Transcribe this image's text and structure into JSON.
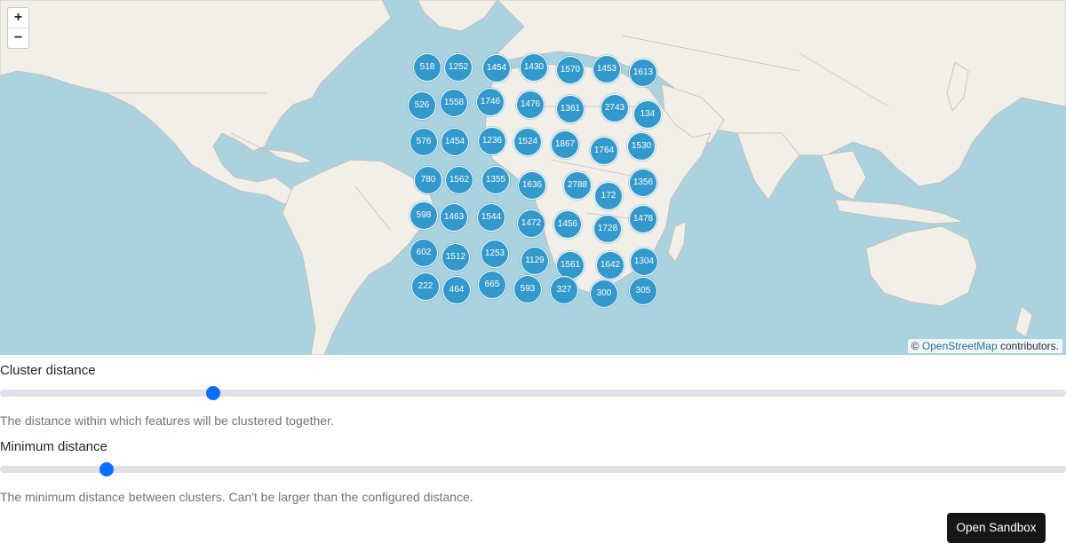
{
  "map": {
    "zoom_in_label": "+",
    "zoom_out_label": "−",
    "attribution_prefix": "© ",
    "attribution_link": "OpenStreetMap",
    "attribution_suffix": " contributors.",
    "cluster_color": "#3399cc",
    "clusters": [
      [
        518,
        1252,
        1454,
        1430,
        1570,
        1453,
        1613
      ],
      [
        526,
        1558,
        1746,
        1476,
        1361,
        2743,
        134
      ],
      [
        576,
        1454,
        1236,
        1524,
        1867,
        1764,
        1530
      ],
      [
        780,
        1562,
        1355,
        1636,
        2788,
        172,
        1356
      ],
      [
        598,
        1463,
        1544,
        1472,
        1456,
        1728,
        1478
      ],
      [
        602,
        1512,
        1253,
        1129,
        1561,
        1642,
        1304
      ],
      [
        222,
        464,
        665,
        593,
        327,
        300,
        305
      ]
    ]
  },
  "controls": {
    "cluster_distance": {
      "label": "Cluster distance",
      "value_fraction": 0.2,
      "help": "The distance within which features will be clustered together."
    },
    "minimum_distance": {
      "label": "Minimum distance",
      "value_fraction": 0.1,
      "help": "The minimum distance between clusters. Can't be larger than the configured distance."
    }
  },
  "sandbox_button": "Open Sandbox"
}
